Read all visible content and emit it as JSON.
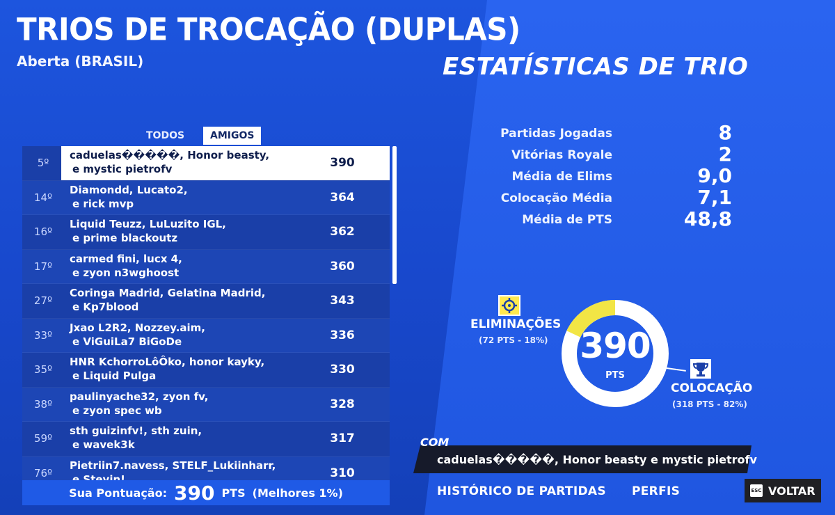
{
  "header": {
    "title": "TRIOS DE TROCAÇÃO (DUPLAS)",
    "subtitle": "Aberta (BRASIL)",
    "stats_title": "ESTATÍSTICAS DE TRIO"
  },
  "tabs": [
    {
      "label": "TODOS",
      "active": false
    },
    {
      "label": "AMIGOS",
      "active": true
    }
  ],
  "leaderboard": [
    {
      "rank": "5º",
      "line1": "caduelas�����, Honor beasty,",
      "line2": "e mystic pietrofv",
      "score": "390",
      "highlighted": true
    },
    {
      "rank": "14º",
      "line1": "Diamondd, Lucato2,",
      "line2": "e rick mvp",
      "score": "364"
    },
    {
      "rank": "16º",
      "line1": "Liquid Teuzz, LuLuzito IGL,",
      "line2": "e prime blackoutz",
      "score": "362"
    },
    {
      "rank": "17º",
      "line1": "carmed fini, lucx 4,",
      "line2": "e zyon n3wghoost",
      "score": "360"
    },
    {
      "rank": "27º",
      "line1": "Coringa Madrid, Gelatina Madrid,",
      "line2": "e Kp7blood",
      "score": "343"
    },
    {
      "rank": "33º",
      "line1": "Jxao L2R2, Nozzey.aim,",
      "line2": "e ViGuiLa7 BiGoDe",
      "score": "336"
    },
    {
      "rank": "35º",
      "line1": "HNR KchorroLôÔko, honor kayky,",
      "line2": "e Liquid Pulga",
      "score": "330"
    },
    {
      "rank": "38º",
      "line1": "paulinyache32, zyon fv,",
      "line2": "e zyon spec wb",
      "score": "328"
    },
    {
      "rank": "59º",
      "line1": "sth guizinfv!, sth zuin,",
      "line2": "e wavek3k",
      "score": "317"
    },
    {
      "rank": "76º",
      "line1": "Pietriin7.navess, STELF_Lukiinharr,",
      "line2": "e Stevin!",
      "score": "310"
    }
  ],
  "score_footer": {
    "label": "Sua Pontuação:",
    "value": "390",
    "unit": "PTS",
    "percentile": "(Melhores 1%)"
  },
  "stats": [
    {
      "label": "Partidas Jogadas",
      "value": "8"
    },
    {
      "label": "Vitórias Royale",
      "value": "2"
    },
    {
      "label": "Média de Elims",
      "value": "9,0"
    },
    {
      "label": "Colocação Média",
      "value": "7,1"
    },
    {
      "label": "Média de PTS",
      "value": "48,8"
    }
  ],
  "donut": {
    "total": "390",
    "total_label": "PTS",
    "elims_label": "ELIMINAÇÕES",
    "elims_sub": "(72 PTS - 18%)",
    "elims_fraction": 0.18,
    "placement_label": "COLOCAÇÃO",
    "placement_sub": "(318 PTS - 82%)",
    "placement_fraction": 0.82,
    "colors": {
      "elims": "#f2e545",
      "placement": "#ffffff"
    }
  },
  "com": {
    "tag": "COM",
    "text": "caduelas�����, Honor beasty e mystic pietrofv"
  },
  "nav": {
    "history": "HISTÓRICO DE PARTIDAS",
    "profiles": "PERFIS",
    "back_key": "ESC",
    "back": "VOLTAR"
  }
}
